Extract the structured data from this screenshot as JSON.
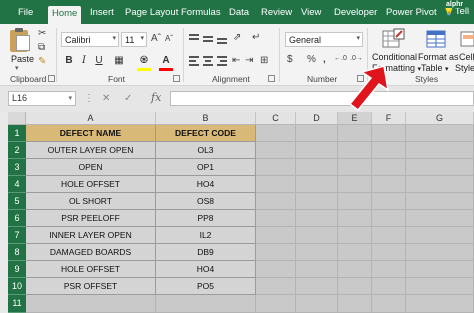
{
  "brand": "alphr",
  "tabs": [
    {
      "label": "File",
      "active": false
    },
    {
      "label": "Home",
      "active": true
    },
    {
      "label": "Insert",
      "active": false
    },
    {
      "label": "Page Layout",
      "active": false
    },
    {
      "label": "Formulas",
      "active": false
    },
    {
      "label": "Data",
      "active": false
    },
    {
      "label": "Review",
      "active": false
    },
    {
      "label": "View",
      "active": false
    },
    {
      "label": "Developer",
      "active": false
    },
    {
      "label": "Power Pivot",
      "active": false
    }
  ],
  "tell_me": "Tell",
  "ribbon": {
    "clipboard": {
      "paste_label": "Paste",
      "group_label": "Clipboard"
    },
    "font": {
      "font_name": "Calibri",
      "font_size": "11",
      "group_label": "Font",
      "fill_color": "#ffff00",
      "font_color": "#ff0000"
    },
    "alignment": {
      "group_label": "Alignment"
    },
    "number": {
      "format": "General",
      "group_label": "Number"
    },
    "styles": {
      "conditional_line1": "Conditional",
      "conditional_line2": "Formatting",
      "format_table_line1": "Format as",
      "format_table_line2": "Table",
      "cell_styles_line1": "Cell",
      "cell_styles_line2": "Styles",
      "group_label": "Styles"
    }
  },
  "formula_bar": {
    "name_box": "L16",
    "fx": "fx",
    "content": ""
  },
  "columns": [
    "A",
    "B",
    "C",
    "D",
    "E",
    "F",
    "G"
  ],
  "selected_column": "E",
  "rows": [
    "1",
    "2",
    "3",
    "4",
    "5",
    "6",
    "7",
    "8",
    "9",
    "10",
    "11"
  ],
  "table": {
    "headers": [
      "DEFECT NAME",
      "DEFECT CODE"
    ],
    "rows": [
      [
        "OUTER LAYER OPEN",
        "OL3"
      ],
      [
        "OPEN",
        "OP1"
      ],
      [
        "HOLE OFFSET",
        "HO4"
      ],
      [
        "OL SHORT",
        "OS8"
      ],
      [
        "PSR PEELOFF",
        "PP8"
      ],
      [
        "INNER LAYER OPEN",
        "IL2"
      ],
      [
        "DAMAGED BOARDS",
        "DB9"
      ],
      [
        "HOLE OFFSET",
        "HO4"
      ],
      [
        "PSR OFFSET",
        "PO5"
      ]
    ]
  },
  "colors": {
    "excel_green": "#217346",
    "header_fill": "#d9b977",
    "cell_fill": "#d4d4d4",
    "arrow_red": "#e0141c"
  }
}
